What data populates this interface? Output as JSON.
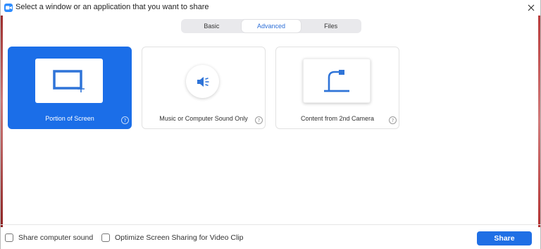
{
  "window": {
    "title": "Select a window or an application that you want to share"
  },
  "tabs": [
    {
      "label": "Basic",
      "active": false
    },
    {
      "label": "Advanced",
      "active": true
    },
    {
      "label": "Files",
      "active": false
    }
  ],
  "cards": [
    {
      "label": "Portion of Screen",
      "selected": true,
      "icon": "portion-of-screen-icon"
    },
    {
      "label": "Music or Computer Sound Only",
      "selected": false,
      "icon": "speaker-icon"
    },
    {
      "label": "Content from 2nd Camera",
      "selected": false,
      "icon": "document-camera-icon"
    }
  ],
  "help_glyph": "?",
  "bottom": {
    "share_sound_label": "Share computer sound",
    "share_sound_checked": false,
    "optimize_label": "Optimize Screen Sharing for Video Clip",
    "optimize_checked": false,
    "share_button": "Share"
  },
  "colors": {
    "accent": "#1f6fe5",
    "selected_card": "#1b6ee8",
    "tab_active_text": "#2d6fd7",
    "icon_blue": "#2f74d8"
  }
}
